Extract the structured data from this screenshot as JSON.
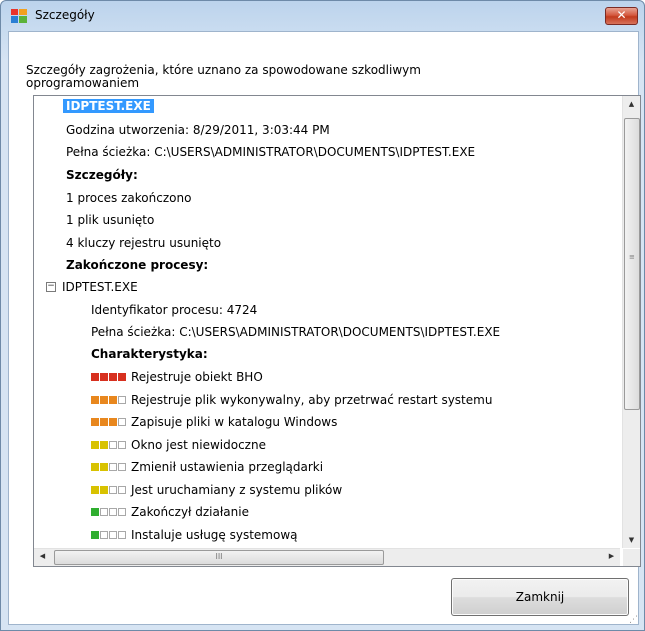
{
  "window": {
    "title": "Szczegóły",
    "close_glyph": "✕"
  },
  "heading": "Szczegóły zagrożenia, które uznano za spowodowane szkodliwym oprogramowaniem",
  "details": {
    "file_name": "IDPTEST.EXE",
    "creation_time": "Godzina utworzenia: 8/29/2011, 3:03:44 PM",
    "full_path": "Pełna ścieżka: C:\\USERS\\ADMINISTRATOR\\DOCUMENTS\\IDPTEST.EXE",
    "section_details": "Szczegóły:",
    "processes_ended": "1 proces zakończono",
    "files_removed": "1 plik usunięto",
    "registry_removed": "4 kluczy rejestru usunięto",
    "section_processes": "Zakończone procesy:"
  },
  "process": {
    "name": "IDPTEST.EXE",
    "pid": "Identyfikator procesu: 4724",
    "full_path": "Pełna ścieżka: C:\\USERS\\ADMINISTRATOR\\DOCUMENTS\\IDPTEST.EXE",
    "characteristics_label": "Charakterystyka:",
    "characteristics": [
      {
        "text": "Rejestruje obiekt BHO",
        "level": 4,
        "color": "#d7301f"
      },
      {
        "text": "Rejestruje plik wykonywalny, aby przetrwać restart systemu",
        "level": 3,
        "color": "#e8871e"
      },
      {
        "text": "Zapisuje pliki w katalogu Windows",
        "level": 3,
        "color": "#e8871e"
      },
      {
        "text": "Okno jest niewidoczne",
        "level": 2,
        "color": "#d8c200"
      },
      {
        "text": "Zmienił ustawienia przeglądarki",
        "level": 2,
        "color": "#d8c200"
      },
      {
        "text": "Jest uruchamiany z systemu plików",
        "level": 2,
        "color": "#d8c200"
      },
      {
        "text": "Zakończył działanie",
        "level": 1,
        "color": "#2fae2f"
      },
      {
        "text": "Instaluje usługę systemową",
        "level": 1,
        "color": "#2fae2f"
      }
    ]
  },
  "scroll": {
    "grip": "≡",
    "h_grip": "III",
    "up": "▲",
    "down": "▼",
    "left": "◀",
    "right": "▶"
  },
  "buttons": {
    "close_label": "Zamknij"
  },
  "tree": {
    "collapse_glyph": "−"
  }
}
